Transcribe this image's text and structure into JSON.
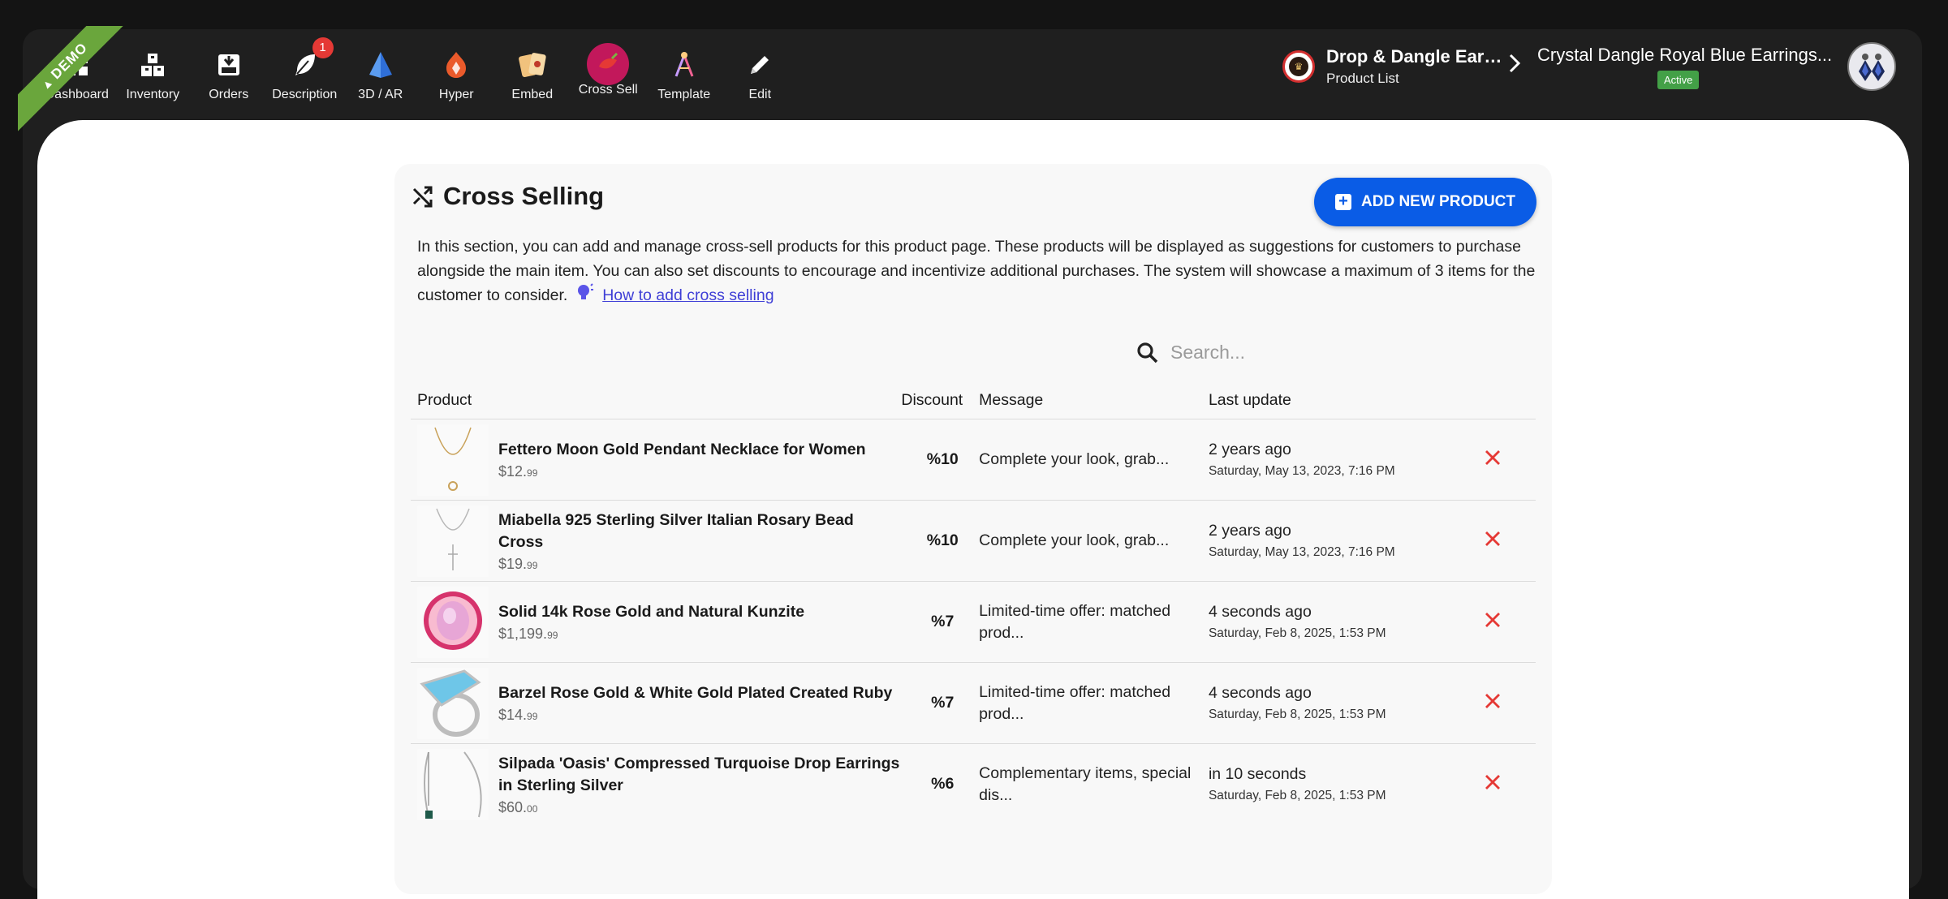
{
  "ribbon": {
    "label": "DEMO"
  },
  "nav": {
    "items": [
      {
        "label": "Dashboard",
        "icon": "dashboard-icon"
      },
      {
        "label": "Inventory",
        "icon": "inventory-boxes-icon"
      },
      {
        "label": "Orders",
        "icon": "orders-tray-icon"
      },
      {
        "label": "Description",
        "icon": "feather-pen-icon",
        "badge": "1"
      },
      {
        "label": "3D / AR",
        "icon": "pyramid-3d-icon"
      },
      {
        "label": "Hyper",
        "icon": "hyper-gem-icon"
      },
      {
        "label": "Embed",
        "icon": "embed-cards-icon"
      },
      {
        "label": "Cross Sell",
        "icon": "cross-sell-icon"
      },
      {
        "label": "Template",
        "icon": "template-compass-icon"
      },
      {
        "label": "Edit",
        "icon": "pencil-icon"
      }
    ]
  },
  "breadcrumb": {
    "store_name": "Drop & Dangle Earr...",
    "store_sub": "Product List",
    "product_name": "Crystal Dangle Royal Blue Earrings...",
    "status": "Active"
  },
  "panel": {
    "title": "Cross Selling",
    "add_button": "ADD NEW PRODUCT",
    "description": "In this section, you can add and manage cross-sell products for this product page. These products will be displayed as suggestions for customers to purchase alongside the main item. You can also set discounts to encourage and incentivize additional purchases. The system will showcase a maximum of 3 items for the customer to consider.",
    "help_link": "How to add cross selling",
    "search_placeholder": "Search..."
  },
  "table": {
    "headers": {
      "product": "Product",
      "discount": "Discount",
      "message": "Message",
      "last_update": "Last update"
    },
    "rows": [
      {
        "name": "Fettero Moon Gold Pendant Necklace for Women",
        "price_main": "$12.",
        "price_cents": "99",
        "discount": "%10",
        "message": "Complete your look, grab...",
        "rel": "2 years ago",
        "abs": "Saturday, May 13, 2023, 7:16 PM",
        "thumb": "gold-necklace"
      },
      {
        "name": "Miabella 925 Sterling Silver Italian Rosary Bead Cross",
        "price_main": "$19.",
        "price_cents": "99",
        "discount": "%10",
        "message": "Complete your look, grab...",
        "rel": "2 years ago",
        "abs": "Saturday, May 13, 2023, 7:16 PM",
        "thumb": "silver-rosary"
      },
      {
        "name": "Solid 14k Rose Gold and Natural Kunzite",
        "price_main": "$1,199.",
        "price_cents": "99",
        "discount": "%7",
        "message": "Limited-time offer: matched prod...",
        "rel": "4 seconds ago",
        "abs": "Saturday, Feb 8, 2025, 1:53 PM",
        "thumb": "kunzite-ring"
      },
      {
        "name": "Barzel Rose Gold & White Gold Plated Created Ruby",
        "price_main": "$14.",
        "price_cents": "99",
        "discount": "%7",
        "message": "Limited-time offer: matched prod...",
        "rel": "4 seconds ago",
        "abs": "Saturday, Feb 8, 2025, 1:53 PM",
        "thumb": "turquoise-ring"
      },
      {
        "name": "Silpada 'Oasis' Compressed Turquoise Drop Earrings in Sterling Silver",
        "price_main": "$60.",
        "price_cents": "00",
        "discount": "%6",
        "message": "Complementary items, special dis...",
        "rel": "in 10 seconds",
        "abs": "Saturday, Feb 8, 2025, 1:53 PM",
        "thumb": "drop-earrings"
      }
    ]
  },
  "colors": {
    "accent": "#0a5ce6",
    "ribbon": "#6aa63c",
    "delete": "#e53935",
    "active": "#43a047",
    "topbar": "#1f1f1f"
  }
}
